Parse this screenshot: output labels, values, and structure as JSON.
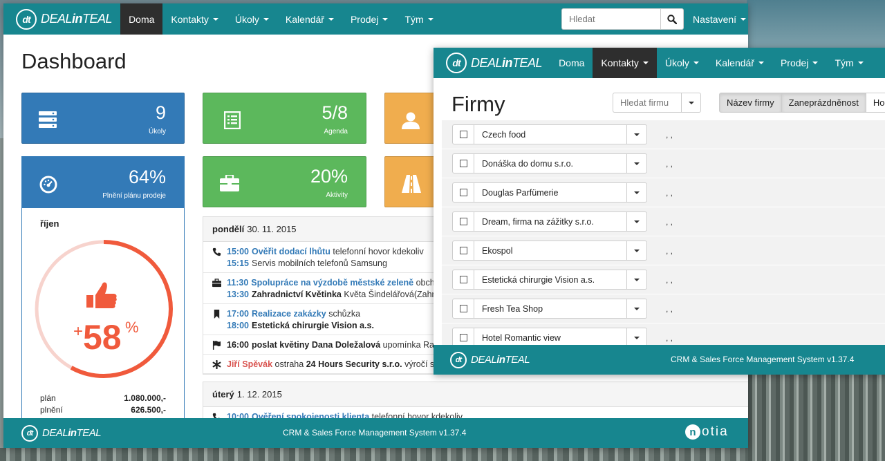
{
  "brand": {
    "logo_text": "dt",
    "name_prefix": "DEAL",
    "name_mid": "in",
    "name_suffix": "TEAL"
  },
  "nav": [
    {
      "label": "Doma",
      "caret": false
    },
    {
      "label": "Kontakty",
      "caret": true
    },
    {
      "label": "Úkoly",
      "caret": true
    },
    {
      "label": "Kalendář",
      "caret": true
    },
    {
      "label": "Prodej",
      "caret": true
    },
    {
      "label": "Tým",
      "caret": true
    }
  ],
  "search": {
    "placeholder": "Hledat"
  },
  "settings_label": "Nastavení",
  "dashboard": {
    "title": "Dashboard",
    "tiles": [
      {
        "value": "9",
        "label": "Úkoly",
        "icon": "server-icon",
        "color": "#337ab7"
      },
      {
        "value": "5/8",
        "label": "Agenda",
        "icon": "list-icon",
        "color": "#5cb85c"
      },
      {
        "value": "",
        "label": "",
        "icon": "user-icon",
        "color": "#f0ad4e"
      },
      {
        "value": "20%",
        "label": "Aktivity",
        "icon": "briefcase-icon",
        "color": "#5cb85c"
      },
      {
        "value": "",
        "label": "",
        "icon": "road-icon",
        "color": "#f0ad4e"
      }
    ],
    "sales": {
      "value": "64%",
      "label": "Plnění plánu prodeje",
      "month": "říjen",
      "gauge_sign": "+",
      "gauge_value": "58",
      "gauge_unit": "%",
      "gauge_fraction": 0.58,
      "plan_label": "plán",
      "plan_value": "1.080.000,-",
      "done_label": "plnění",
      "done_value": "626.500,-"
    }
  },
  "agenda_days": [
    {
      "day": "pondělí",
      "date": "30. 11. 2015",
      "events": [
        {
          "icon": "phone-icon",
          "lines": [
            {
              "time": "15:00",
              "link": "Ověřit dodací lhůtu",
              "rest": "telefonní hovor kdekoliv"
            },
            {
              "time": "15:15",
              "link": "",
              "rest": "Servis mobilních telefonů Samsung"
            }
          ]
        },
        {
          "icon": "briefcase-icon",
          "lines": [
            {
              "time": "11:30",
              "link": "Spolupráce na výzdobě městské zeleně",
              "rest": "obchod"
            },
            {
              "time": "13:30",
              "bold": "Zahradnictví Květinka",
              "rest": "Květa Šindelářová(Zahra"
            }
          ]
        },
        {
          "icon": "bookmark-icon",
          "lines": [
            {
              "time": "17:00",
              "link": "Realizace zakázky",
              "rest": "schůzka"
            },
            {
              "time": "18:00",
              "bold": "Estetická chirurgie Vision a.s.",
              "rest": ""
            }
          ]
        },
        {
          "icon": "flag-icon",
          "lines": [
            {
              "time_black": "16:00",
              "bold": "poslat květiny Dana Doležalová",
              "rest": "upomínka Rad"
            }
          ]
        },
        {
          "icon": "asterisk-icon",
          "lines": [
            {
              "red": "Jiří Spěvák",
              "rest": "ostraha",
              "bold_after": "24 Hours Security s.r.o.",
              "rest_after": "výročí sv"
            }
          ]
        }
      ]
    },
    {
      "day": "úterý",
      "date": "1. 12. 2015",
      "events": [
        {
          "icon": "phone-icon",
          "lines": [
            {
              "time": "10:00",
              "link": "Ověření spokojenosti klienta",
              "rest": "telefonní hovor kdekoliv"
            }
          ]
        }
      ]
    }
  ],
  "footer": {
    "version": "CRM & Sales Force Management System v1.37.4",
    "partner": "notia",
    "partner_o": "n",
    "partner_rest": "otia"
  },
  "firms": {
    "title": "Firmy",
    "search_placeholder": "Hledat firmu",
    "sort_buttons": [
      "Název firmy",
      "Zaneprázdněnost",
      "Hodn"
    ],
    "rows": [
      {
        "name": "Czech food",
        "meta": ", ,"
      },
      {
        "name": "Donáška do domu s.r.o.",
        "meta": ", ,"
      },
      {
        "name": "Douglas Parfümerie",
        "meta": ", ,"
      },
      {
        "name": "Dream, firma na zážitky s.r.o.",
        "meta": ", ,"
      },
      {
        "name": "Ekospol",
        "meta": ", ,"
      },
      {
        "name": "Estetická chirurgie Vision a.s.",
        "meta": ", ,"
      },
      {
        "name": "Fresh Tea Shop",
        "meta": ", ,"
      },
      {
        "name": "Hotel Romantic view",
        "meta": ", ,"
      }
    ]
  }
}
